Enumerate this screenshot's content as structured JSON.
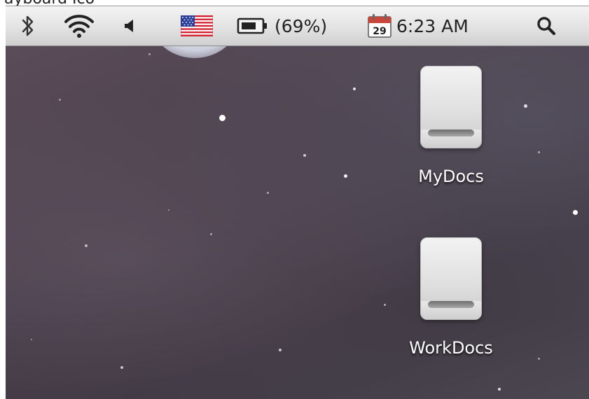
{
  "top_fragment": "ayboard Ico",
  "menubar": {
    "icons": {
      "bluetooth": "bluetooth-icon",
      "wifi": "wifi-icon",
      "volume": "volume-icon",
      "input_menu": "us-flag-icon",
      "battery": "battery-icon",
      "calendar": "calendar-icon",
      "search": "spotlight-search-icon"
    },
    "battery_text": "(69%)",
    "calendar_day": "29",
    "clock": "6:23 AM"
  },
  "desktop": {
    "items": [
      {
        "label": "MyDocs",
        "icon": "hard-drive-icon"
      },
      {
        "label": "WorkDocs",
        "icon": "hard-drive-icon"
      }
    ]
  },
  "colors": {
    "menubar_top": "#f4f4f4",
    "menubar_bottom": "#d0d0d0",
    "desktop": "#4a3f4c",
    "label": "#ffffff"
  }
}
